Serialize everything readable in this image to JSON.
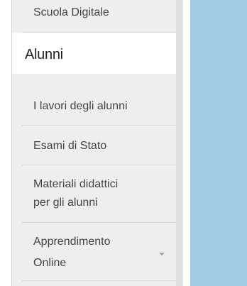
{
  "sidebar": {
    "top_item": "Scuola Digitale",
    "section_title": "Alunni",
    "items": [
      {
        "label": "I lavori degli alunni"
      },
      {
        "label": "Esami di Stato"
      },
      {
        "label": "Materiali didattici",
        "label2": "per gli alunni"
      },
      {
        "label": "Apprendimento",
        "label2": "Online",
        "has_submenu": true
      }
    ]
  },
  "colors": {
    "sidebar_bg": "#eeeeee",
    "content_bg": "#a2cbe5",
    "text": "#444444"
  }
}
